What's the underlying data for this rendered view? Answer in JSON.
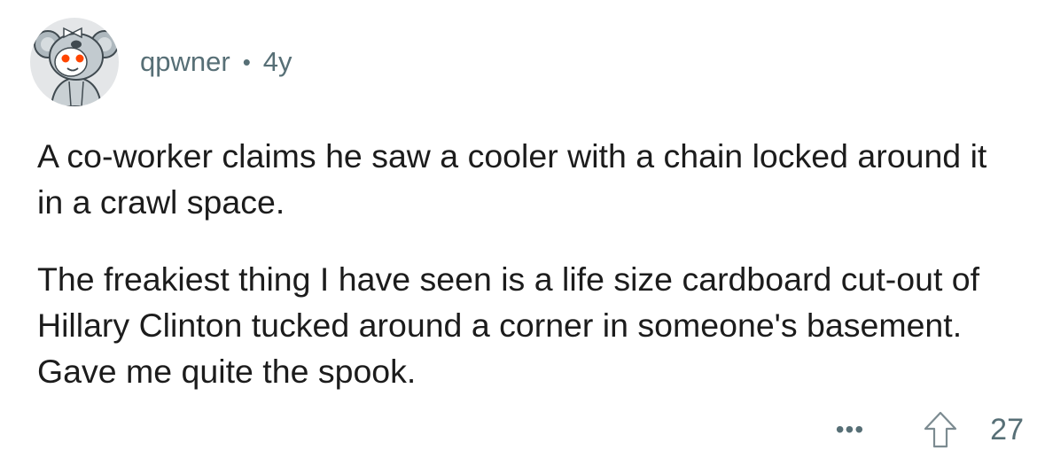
{
  "comment": {
    "username": "qpwner",
    "separator": "•",
    "age": "4y",
    "paragraphs": [
      "A co-worker claims he saw a cooler with a chain locked around it in a crawl space.",
      "The freakiest thing I have seen is a life size cardboard cut-out of Hillary Clinton tucked around a corner in someone's basement. Gave me quite the spook."
    ],
    "more_label": "•••",
    "vote_count": "27"
  },
  "icons": {
    "avatar": "koala-snoo-avatar",
    "more": "more-options-icon",
    "upvote": "upvote-arrow-icon"
  },
  "colors": {
    "text": "#1c1c1c",
    "meta": "#576f76",
    "avatar_bg": "#e4e6e8",
    "cheeks": "#ff4500"
  }
}
